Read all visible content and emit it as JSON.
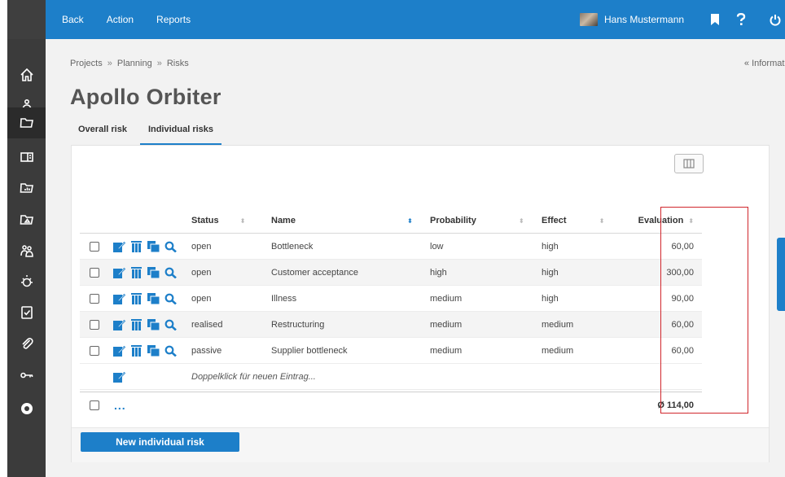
{
  "topbar": {
    "nav": [
      "Back",
      "Action",
      "Reports"
    ],
    "user_name": "Hans Mustermann"
  },
  "breadcrumb": [
    "Projects",
    "Planning",
    "Risks"
  ],
  "breadcrumb_sep": "»",
  "info_link": "« Informatio",
  "page_title": "Apollo Orbiter",
  "tabs": [
    "Overall risk",
    "Individual risks"
  ],
  "table": {
    "columns": [
      "Status",
      "Name",
      "Probability",
      "Effect",
      "Evaluation"
    ],
    "rows": [
      {
        "status": "open",
        "name": "Bottleneck",
        "probability": "low",
        "effect": "high",
        "evaluation": "60,00"
      },
      {
        "status": "open",
        "name": "Customer acceptance",
        "probability": "high",
        "effect": "high",
        "evaluation": "300,00"
      },
      {
        "status": "open",
        "name": "Illness",
        "probability": "medium",
        "effect": "high",
        "evaluation": "90,00"
      },
      {
        "status": "realised",
        "name": "Restructuring",
        "probability": "medium",
        "effect": "medium",
        "evaluation": "60,00"
      },
      {
        "status": "passive",
        "name": "Supplier bottleneck",
        "probability": "medium",
        "effect": "medium",
        "evaluation": "60,00"
      }
    ],
    "new_entry_placeholder": "Doppelklick für neuen Eintrag...",
    "more_label": "...",
    "average": "Ø 114,00"
  },
  "new_button": "New individual risk",
  "colors": {
    "accent": "#1d7fc9",
    "sidebar": "#3b3b3b",
    "highlight": "#d0262c"
  }
}
